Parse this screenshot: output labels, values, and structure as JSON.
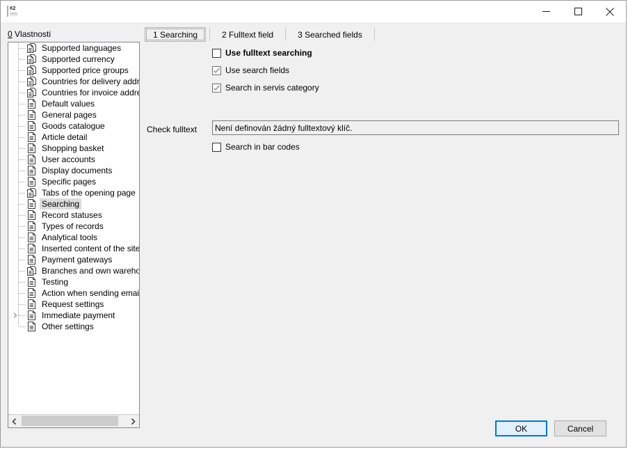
{
  "window": {
    "title": "",
    "icon": "k2-app-icon",
    "controls": {
      "minimize": "minimize-icon",
      "maximize": "maximize-icon",
      "close": "close-icon"
    }
  },
  "left_panel": {
    "label_mnemonic": "0",
    "label_text": " Vlastnosti",
    "tree_items": [
      {
        "label": "Supported languages",
        "icon": "double-page-icon",
        "expandable": false,
        "selected": false
      },
      {
        "label": "Supported currency",
        "icon": "double-page-icon",
        "expandable": false,
        "selected": false
      },
      {
        "label": "Supported price groups",
        "icon": "double-page-icon",
        "expandable": false,
        "selected": false
      },
      {
        "label": "Countries for delivery address",
        "icon": "double-page-icon",
        "expandable": false,
        "selected": false
      },
      {
        "label": "Countries for invoice addresses",
        "icon": "double-page-icon",
        "expandable": false,
        "selected": false
      },
      {
        "label": "Default values",
        "icon": "page-icon",
        "expandable": false,
        "selected": false
      },
      {
        "label": "General pages",
        "icon": "page-icon",
        "expandable": false,
        "selected": false
      },
      {
        "label": "Goods catalogue",
        "icon": "page-icon",
        "expandable": false,
        "selected": false
      },
      {
        "label": "Article detail",
        "icon": "page-icon",
        "expandable": false,
        "selected": false
      },
      {
        "label": "Shopping basket",
        "icon": "page-icon",
        "expandable": false,
        "selected": false
      },
      {
        "label": "User accounts",
        "icon": "page-icon",
        "expandable": false,
        "selected": false
      },
      {
        "label": "Display documents",
        "icon": "page-icon",
        "expandable": false,
        "selected": false
      },
      {
        "label": "Specific pages",
        "icon": "page-icon",
        "expandable": false,
        "selected": false
      },
      {
        "label": "Tabs of the opening page",
        "icon": "double-page-icon",
        "expandable": false,
        "selected": false
      },
      {
        "label": "Searching",
        "icon": "page-icon",
        "expandable": false,
        "selected": true
      },
      {
        "label": "Record statuses",
        "icon": "page-icon",
        "expandable": false,
        "selected": false
      },
      {
        "label": "Types of records",
        "icon": "page-icon",
        "expandable": false,
        "selected": false
      },
      {
        "label": "Analytical tools",
        "icon": "page-icon",
        "expandable": false,
        "selected": false
      },
      {
        "label": "Inserted content of the sites",
        "icon": "page-icon",
        "expandable": false,
        "selected": false
      },
      {
        "label": "Payment gateways",
        "icon": "page-icon",
        "expandable": false,
        "selected": false
      },
      {
        "label": "Branches and own warehouses",
        "icon": "double-page-icon",
        "expandable": false,
        "selected": false
      },
      {
        "label": "Testing",
        "icon": "page-icon",
        "expandable": false,
        "selected": false
      },
      {
        "label": "Action when sending email",
        "icon": "page-icon",
        "expandable": false,
        "selected": false
      },
      {
        "label": "Request settings",
        "icon": "page-icon",
        "expandable": false,
        "selected": false
      },
      {
        "label": "Immediate payment",
        "icon": "page-icon",
        "expandable": true,
        "selected": false
      },
      {
        "label": "Other settings",
        "icon": "page-icon",
        "expandable": false,
        "selected": false
      }
    ],
    "scrollbar": {
      "left_arrow": "chevron-left-icon",
      "right_arrow": "chevron-right-icon"
    }
  },
  "tabs": [
    {
      "label": "1 Searching",
      "active": true
    },
    {
      "label": "2 Fulltext field",
      "active": false
    },
    {
      "label": "3 Searched fields",
      "active": false
    }
  ],
  "searching_tab": {
    "checkboxes": [
      {
        "label": "Use fulltext searching",
        "checked": false,
        "bold": true
      },
      {
        "label": "Use search fields",
        "checked": true,
        "bold": false
      },
      {
        "label": "Search in servis category",
        "checked": true,
        "bold": false
      },
      {
        "label": "Search in bar codes",
        "checked": false,
        "bold": false
      }
    ],
    "check_fulltext_label": "Check fulltext",
    "check_fulltext_value": "Není definován žádný fulltextový klíč.",
    "check_fulltext_placeholder": ""
  },
  "footer": {
    "ok_label": "OK",
    "cancel_label": "Cancel"
  },
  "colors": {
    "accent": "#0078d7",
    "dialog_bg": "#f0f0f0",
    "tree_bg": "#ffffff",
    "selection_bg": "#dcdcdc"
  }
}
